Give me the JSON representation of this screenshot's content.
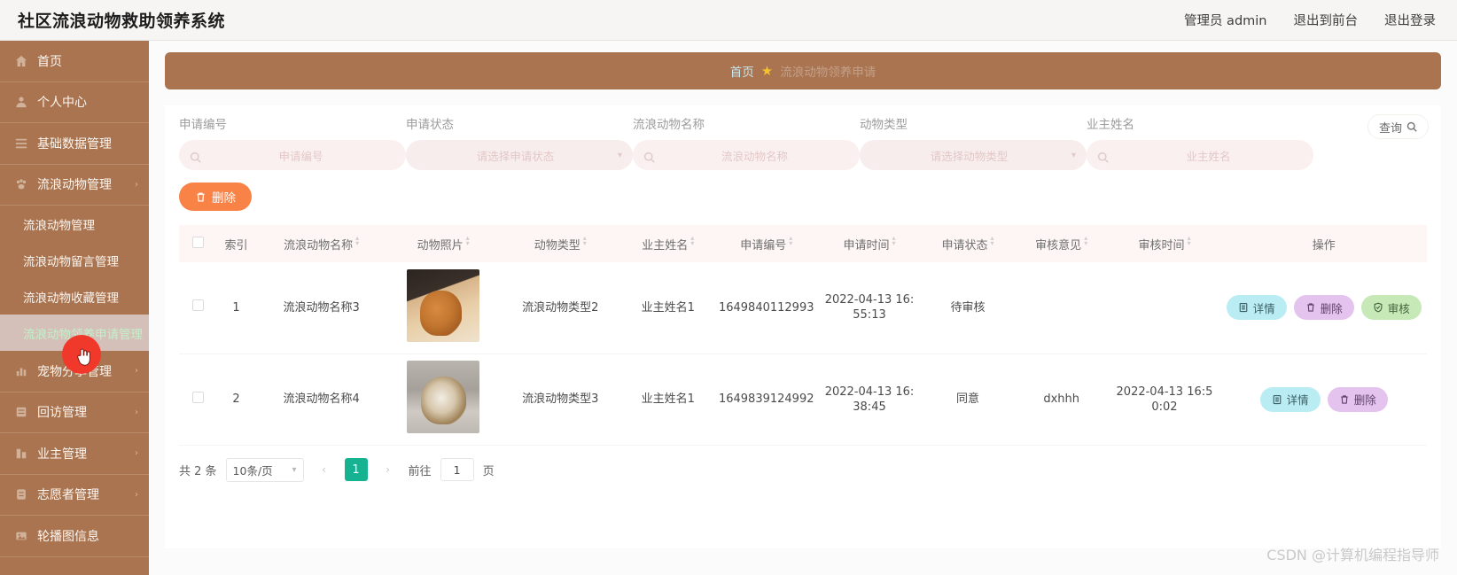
{
  "header": {
    "app_title": "社区流浪动物救助领养系统",
    "user_label": "管理员 admin",
    "logout_front_label": "退出到前台",
    "logout_label": "退出登录"
  },
  "sidebar": {
    "items": [
      {
        "label": "首页",
        "icon": "home-icon",
        "type": "item",
        "expandable": false
      },
      {
        "label": "个人中心",
        "icon": "user-icon",
        "type": "item",
        "expandable": false
      },
      {
        "label": "基础数据管理",
        "icon": "list-icon",
        "type": "item",
        "expandable": true
      },
      {
        "label": "流浪动物管理",
        "icon": "paw-icon",
        "type": "item",
        "expandable": true
      },
      {
        "label": "流浪动物管理",
        "type": "sub",
        "active": false
      },
      {
        "label": "流浪动物留言管理",
        "type": "sub",
        "active": false
      },
      {
        "label": "流浪动物收藏管理",
        "type": "sub",
        "active": false
      },
      {
        "label": "流浪动物领养申请管理",
        "type": "sub",
        "active": true
      },
      {
        "label": "宠物分享管理",
        "icon": "chart-icon",
        "type": "item",
        "expandable": true
      },
      {
        "label": "回访管理",
        "icon": "clipboard-icon",
        "type": "item",
        "expandable": true
      },
      {
        "label": "业主管理",
        "icon": "building-icon",
        "type": "item",
        "expandable": true
      },
      {
        "label": "志愿者管理",
        "icon": "badge-icon",
        "type": "item",
        "expandable": true
      },
      {
        "label": "轮播图信息",
        "icon": "image-icon",
        "type": "item",
        "expandable": false
      }
    ]
  },
  "breadcrumb": {
    "home": "首页",
    "star": "★",
    "current": "流浪动物领养申请"
  },
  "filters": {
    "query_label": "查询",
    "fields": [
      {
        "label": "申请编号",
        "placeholder": "申请编号",
        "kind": "search"
      },
      {
        "label": "申请状态",
        "placeholder": "请选择申请状态",
        "kind": "select"
      },
      {
        "label": "流浪动物名称",
        "placeholder": "流浪动物名称",
        "kind": "search"
      },
      {
        "label": "动物类型",
        "placeholder": "请选择动物类型",
        "kind": "select"
      },
      {
        "label": "业主姓名",
        "placeholder": "业主姓名",
        "kind": "search"
      }
    ]
  },
  "toolbar": {
    "delete_label": "删除"
  },
  "table": {
    "columns": [
      {
        "label": "",
        "sortable": false,
        "key": "checkbox"
      },
      {
        "label": "索引",
        "sortable": false,
        "key": "index"
      },
      {
        "label": "流浪动物名称",
        "sortable": true,
        "key": "animal_name"
      },
      {
        "label": "动物照片",
        "sortable": true,
        "key": "photo"
      },
      {
        "label": "动物类型",
        "sortable": true,
        "key": "animal_type"
      },
      {
        "label": "业主姓名",
        "sortable": true,
        "key": "owner_name"
      },
      {
        "label": "申请编号",
        "sortable": true,
        "key": "apply_no"
      },
      {
        "label": "申请时间",
        "sortable": true,
        "key": "apply_time"
      },
      {
        "label": "申请状态",
        "sortable": true,
        "key": "apply_status"
      },
      {
        "label": "审核意见",
        "sortable": true,
        "key": "review_note"
      },
      {
        "label": "审核时间",
        "sortable": true,
        "key": "review_time"
      },
      {
        "label": "操作",
        "sortable": false,
        "key": "actions"
      }
    ],
    "rows": [
      {
        "index": "1",
        "animal_name": "流浪动物名称3",
        "photo": "cat-photo",
        "animal_type": "流浪动物类型2",
        "owner_name": "业主姓名1",
        "apply_no": "1649840112993",
        "apply_time": "2022-04-13 16:55:13",
        "apply_status": "待审核",
        "review_note": "",
        "review_time": "",
        "actions": [
          {
            "label": "详情",
            "style": "detail",
            "icon": "document-icon"
          },
          {
            "label": "删除",
            "style": "delete",
            "icon": "trash-icon"
          },
          {
            "label": "审核",
            "style": "audit",
            "icon": "check-shield-icon"
          }
        ]
      },
      {
        "index": "2",
        "animal_name": "流浪动物名称4",
        "photo": "dog-photo",
        "animal_type": "流浪动物类型3",
        "owner_name": "业主姓名1",
        "apply_no": "1649839124992",
        "apply_time": "2022-04-13 16:38:45",
        "apply_status": "同意",
        "review_note": "dxhhh",
        "review_time": "2022-04-13 16:50:02",
        "actions": [
          {
            "label": "详情",
            "style": "detail",
            "icon": "document-icon"
          },
          {
            "label": "删除",
            "style": "delete",
            "icon": "trash-icon"
          }
        ]
      }
    ]
  },
  "pagination": {
    "total_text": "共 2 条",
    "page_size_label": "10条/页",
    "prev_icon": "chevron-left-icon",
    "next_icon": "chevron-right-icon",
    "current_page": "1",
    "goto_label": "前往",
    "goto_value": "1",
    "page_unit": "页"
  },
  "watermark": "CSDN @计算机编程指导师",
  "colors": {
    "sidebar": "#a9744f",
    "accent_orange": "#f98247",
    "pager_green": "#15b392",
    "breadcrumb": "#a9744f"
  }
}
